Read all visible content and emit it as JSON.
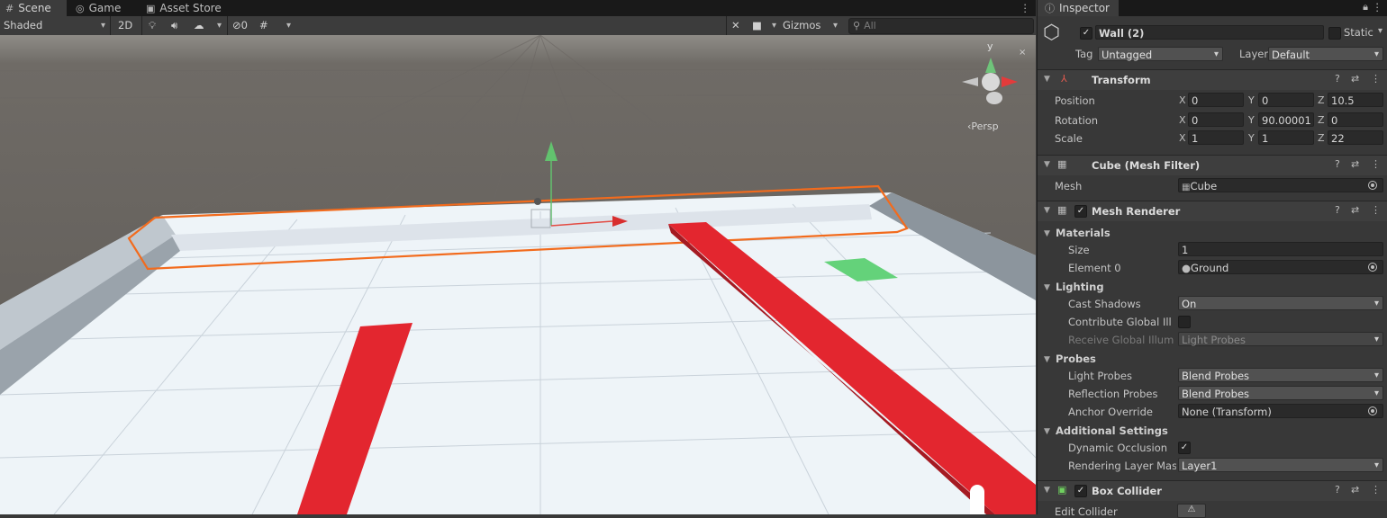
{
  "scene_tabs": {
    "scene": {
      "label": "Scene",
      "icon": "grid-icon"
    },
    "game": {
      "label": "Game",
      "icon": "gamepad-icon"
    },
    "asset_store": {
      "label": "Asset Store",
      "icon": "shopping-bag-icon"
    }
  },
  "toolbar": {
    "draw_mode": "Shaded",
    "mode_2d": "2D",
    "lighting_icon": "lightbulb-icon",
    "audio_icon": "speaker-icon",
    "effects_icon": "effects-icon",
    "hidden_count": "0",
    "grid_icon": "grid-snap-icon",
    "tools_icon": "tools-icon",
    "camera_icon": "camera-icon",
    "gizmos": "Gizmos",
    "search_placeholder": "All"
  },
  "gizmo": {
    "y_label": "y",
    "persp_label": "‹Persp"
  },
  "inspector": {
    "tab_label": "Inspector",
    "object_name": "Wall (2)",
    "static_label": "Static",
    "tag_label": "Tag",
    "tag_value": "Untagged",
    "layer_label": "Layer",
    "layer_value": "Default",
    "transform": {
      "title": "Transform",
      "position": {
        "label": "Position",
        "x": "0",
        "y": "0",
        "z": "10.5"
      },
      "rotation": {
        "label": "Rotation",
        "x": "0",
        "y": "90.00001",
        "z": "0"
      },
      "scale": {
        "label": "Scale",
        "x": "1",
        "y": "1",
        "z": "22"
      }
    },
    "mesh_filter": {
      "title": "Cube (Mesh Filter)",
      "mesh_label": "Mesh",
      "mesh_value": "Cube"
    },
    "mesh_renderer": {
      "title": "Mesh Renderer",
      "materials": "Materials",
      "size_label": "Size",
      "size_value": "1",
      "element0_label": "Element 0",
      "element0_value": "Ground",
      "lighting": "Lighting",
      "cast_shadows_label": "Cast Shadows",
      "cast_shadows_value": "On",
      "contribute_gi_label": "Contribute Global Illu",
      "receive_gi_label": "Receive Global Illum",
      "receive_gi_value": "Light Probes",
      "probes": "Probes",
      "light_probes_label": "Light Probes",
      "light_probes_value": "Blend Probes",
      "reflection_probes_label": "Reflection Probes",
      "reflection_probes_value": "Blend Probes",
      "anchor_override_label": "Anchor Override",
      "anchor_override_value": "None (Transform)",
      "additional": "Additional Settings",
      "dynamic_occlusion_label": "Dynamic Occlusion",
      "rendering_layer_label": "Rendering Layer Mas",
      "rendering_layer_value": "Layer1"
    },
    "box_collider": {
      "title": "Box Collider",
      "edit_collider_label": "Edit Collider"
    }
  },
  "colors": {
    "selection": "#f26b1d",
    "obstacle": "#e3262f",
    "goal": "#64d27a"
  }
}
